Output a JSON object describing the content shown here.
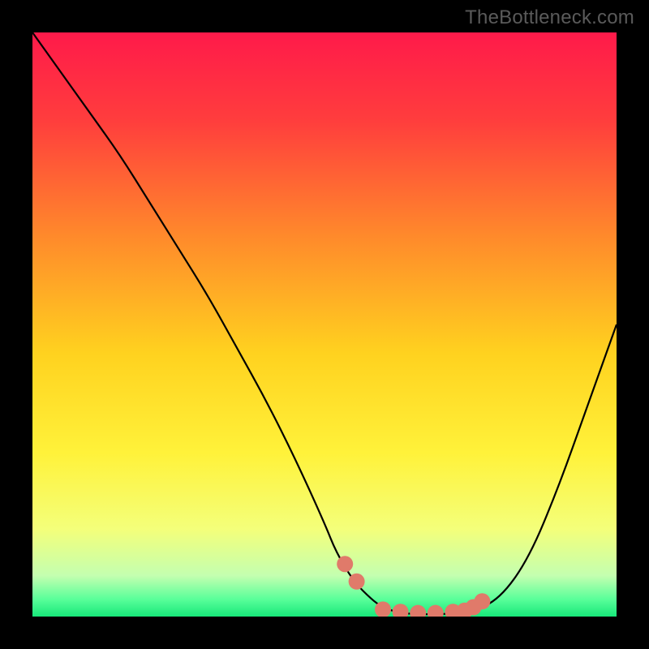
{
  "watermark": "TheBottleneck.com",
  "chart_data": {
    "type": "line",
    "title": "",
    "xlabel": "",
    "ylabel": "",
    "xlim": [
      0,
      100
    ],
    "ylim": [
      0,
      100
    ],
    "background_gradient": {
      "stops": [
        {
          "offset": 0.0,
          "color": "#ff1a4a"
        },
        {
          "offset": 0.15,
          "color": "#ff3d3d"
        },
        {
          "offset": 0.35,
          "color": "#ff8a2b"
        },
        {
          "offset": 0.55,
          "color": "#ffd21f"
        },
        {
          "offset": 0.72,
          "color": "#fff23a"
        },
        {
          "offset": 0.85,
          "color": "#f4ff7a"
        },
        {
          "offset": 0.93,
          "color": "#c4ffb0"
        },
        {
          "offset": 0.97,
          "color": "#5aff9a"
        },
        {
          "offset": 1.0,
          "color": "#17e87a"
        }
      ]
    },
    "series": [
      {
        "name": "bottleneck-curve",
        "type": "line",
        "stroke": "#000000",
        "stroke_width": 2.2,
        "x": [
          0,
          5,
          10,
          15,
          20,
          25,
          30,
          35,
          40,
          45,
          50,
          52,
          55,
          58,
          60,
          63,
          66,
          70,
          75,
          80,
          85,
          90,
          95,
          100
        ],
        "y": [
          100,
          93,
          86,
          79,
          71,
          63,
          55,
          46,
          37,
          27,
          16,
          11,
          6,
          3,
          1.5,
          0.6,
          0.4,
          0.4,
          0.7,
          3,
          10,
          22,
          36,
          50
        ]
      },
      {
        "name": "optimal-range-dots",
        "type": "scatter",
        "marker_color": "#e07a6a",
        "marker_radius": 10,
        "x": [
          53.5,
          55.5,
          60,
          63,
          66,
          69,
          72,
          74,
          75.5,
          77
        ],
        "y": [
          9,
          6,
          1.2,
          0.8,
          0.6,
          0.6,
          0.8,
          1.0,
          1.6,
          2.6
        ]
      }
    ]
  }
}
